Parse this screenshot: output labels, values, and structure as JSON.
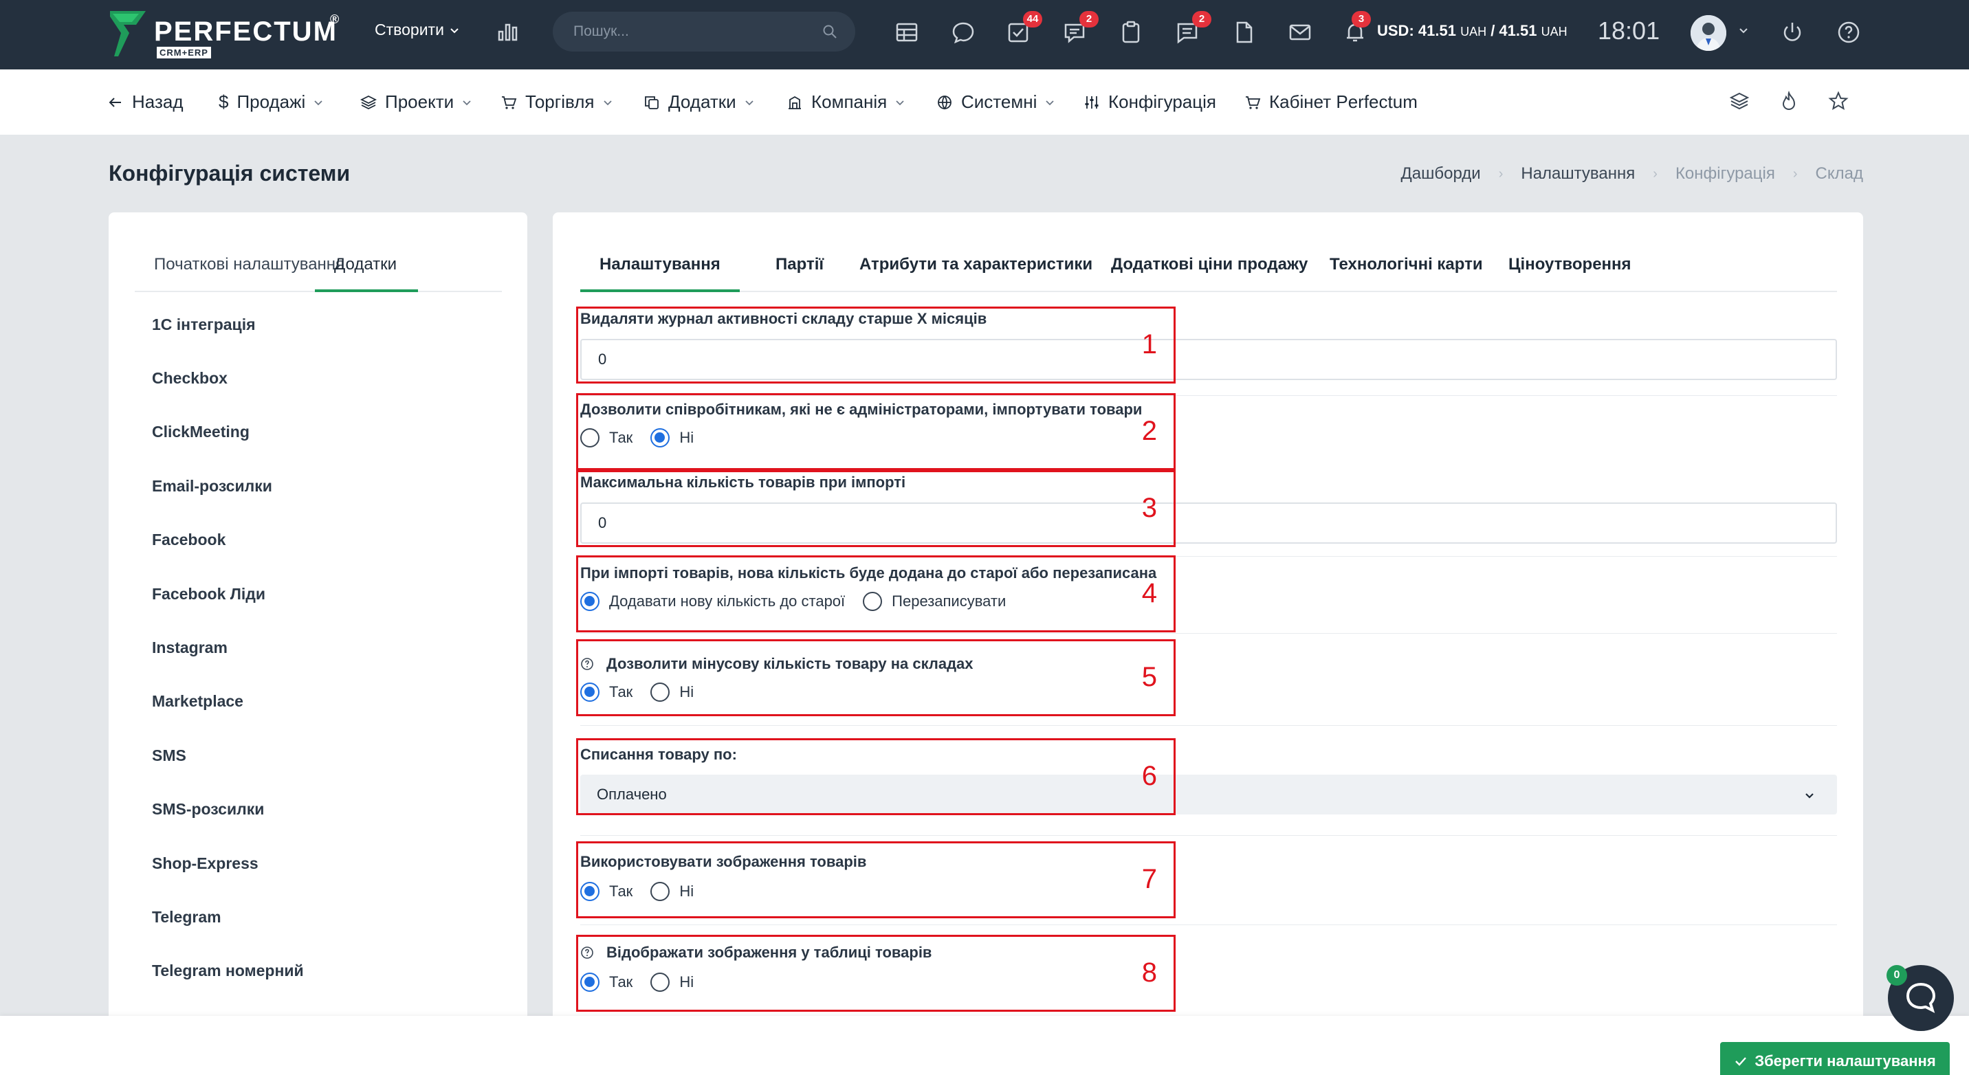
{
  "brand": {
    "name": "PERFECTUM",
    "reg": "®",
    "sub": "CRM+ERP",
    "mark_color": "#1f9c5a"
  },
  "topbar": {
    "create_label": "Створити",
    "search_placeholder": "Пошук...",
    "badges": {
      "tasks": "44",
      "chat": "2",
      "messages": "2",
      "notifications": "3"
    },
    "currency": {
      "label": "USD: 41.51",
      "u1": "UAH",
      "sep": " / 41.51",
      "u2": "UAH"
    },
    "time": "18:01"
  },
  "nav": {
    "back": "Назад",
    "sales": "Продажі",
    "projects": "Проекти",
    "trade": "Торгівля",
    "addons": "Додатки",
    "company": "Компанія",
    "system": "Системні",
    "config": "Конфігурація",
    "cabinet": "Кабінет Perfectum"
  },
  "page": {
    "title": "Конфігурація системи"
  },
  "breadcrumb": [
    "Дашборди",
    "Налаштування",
    "Конфігурація",
    "Склад"
  ],
  "left": {
    "tabs": [
      "Початкові налаштування",
      "Додатки"
    ],
    "items": [
      "1С інтеграція",
      "Checkbox",
      "ClickMeeting",
      "Email-розсилки",
      "Facebook",
      "Facebook Ліди",
      "Instagram",
      "Marketplace",
      "SMS",
      "SMS-розсилки",
      "Shop-Express",
      "Telegram",
      "Telegram номерний"
    ]
  },
  "right": {
    "tabs": [
      "Налаштування",
      "Партії",
      "Атрибути та характеристики",
      "Додаткові ціни продажу",
      "Технологічні карти",
      "Ціноутворення"
    ],
    "fields": {
      "f1": {
        "label": "Видаляти журнал активності складу старше Х місяців",
        "value": "0"
      },
      "f2": {
        "label": "Дозволити співробітникам, які не є адміністраторами, імпортувати товари",
        "opt_yes": "Так",
        "opt_no": "Ні",
        "selected": "no"
      },
      "f3": {
        "label": "Максимальна кількість товарів при імпорті",
        "value": "0"
      },
      "f4": {
        "label": "При імпорті товарів, нова кількість буде додана до старої або перезаписана",
        "opt_a": "Додавати нову кількість до старої",
        "opt_b": "Перезаписувати",
        "selected": "a"
      },
      "f5": {
        "label": "Дозволити мінусову кількість товару на складах",
        "opt_yes": "Так",
        "opt_no": "Ні",
        "selected": "yes"
      },
      "f6": {
        "label": "Списання товару по:",
        "value": "Оплачено"
      },
      "f7": {
        "label": "Використовувати зображення товарів",
        "opt_yes": "Так",
        "opt_no": "Ні",
        "selected": "yes"
      },
      "f8": {
        "label": "Відображати зображення у таблиці товарів",
        "opt_yes": "Так",
        "opt_no": "Ні",
        "selected": "yes"
      }
    }
  },
  "annotations": [
    "1",
    "2",
    "3",
    "4",
    "5",
    "6",
    "7",
    "8"
  ],
  "chat": {
    "badge": "0"
  },
  "save_label": "Зберегти налаштування",
  "colors": {
    "accent": "#1f9c5a",
    "radio": "#1f6fe0",
    "annotation": "#e0131d",
    "topbar": "#24303e"
  }
}
